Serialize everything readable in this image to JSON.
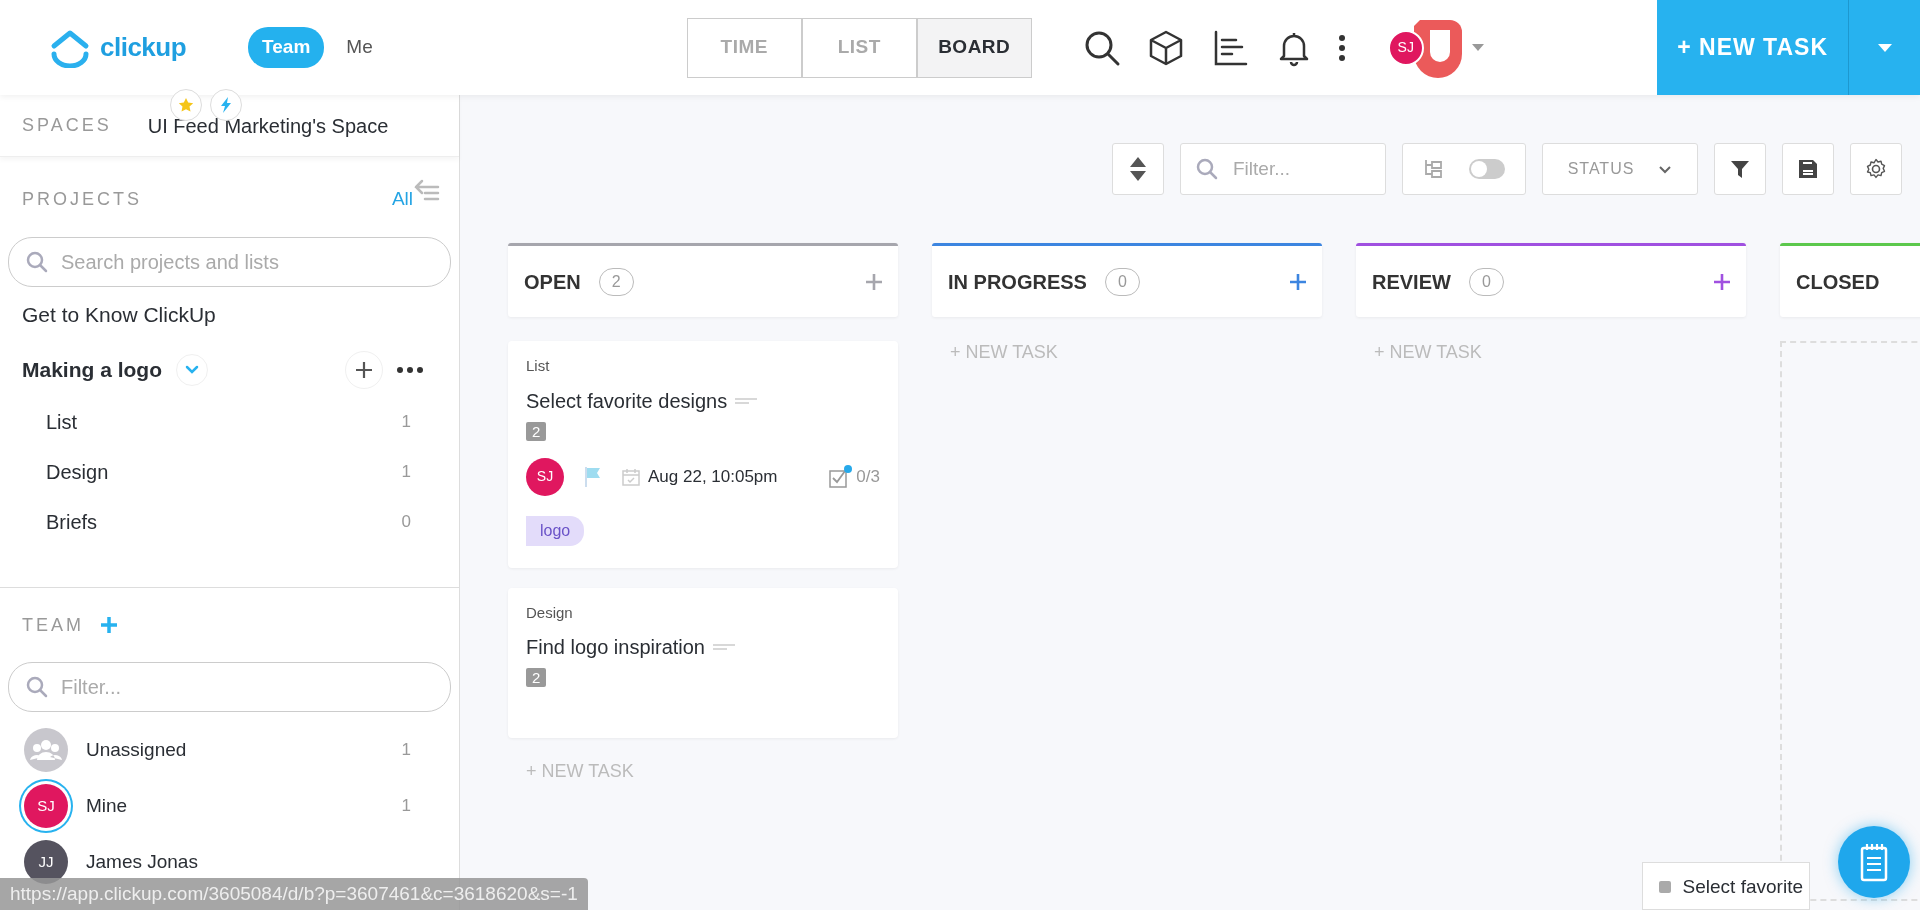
{
  "header": {
    "logo": "clickup",
    "scopes": [
      {
        "label": "Team",
        "selected": true
      },
      {
        "label": "Me",
        "selected": false
      }
    ],
    "views": [
      {
        "label": "TIME",
        "selected": false
      },
      {
        "label": "LIST",
        "selected": false
      },
      {
        "label": "BOARD",
        "selected": true
      }
    ],
    "avatar": "SJ",
    "new_task": "+ NEW TASK"
  },
  "sidebar": {
    "spaces_label": "SPACES",
    "space_name": "UI Feed Marketing's Space",
    "projects_label": "PROJECTS",
    "all_link": "All",
    "search": {
      "placeholder": "Search projects and lists"
    },
    "projects": [
      {
        "name": "Get to Know ClickUp",
        "expanded": false
      },
      {
        "name": "Making a logo",
        "expanded": true,
        "lists": [
          {
            "name": "List",
            "count": "1"
          },
          {
            "name": "Design",
            "count": "1"
          },
          {
            "name": "Briefs",
            "count": "0"
          }
        ]
      }
    ],
    "team_label": "TEAM",
    "filter": {
      "placeholder": "Filter..."
    },
    "members": [
      {
        "kind": "group",
        "name": "Unassigned",
        "count": "1",
        "selected": false
      },
      {
        "kind": "user",
        "initials": "SJ",
        "name": "Mine",
        "count": "1",
        "selected": true,
        "color": "#e0175f"
      },
      {
        "kind": "user",
        "initials": "JJ",
        "name": "James Jonas",
        "selected": false,
        "color": "#55535f"
      }
    ]
  },
  "toolbar": {
    "filter": {
      "placeholder": "Filter..."
    },
    "subtasks_on": false,
    "status": "STATUS"
  },
  "columns": [
    {
      "name": "OPEN",
      "count": "2",
      "color": "#a6a6ad",
      "new_task": "+ NEW TASK",
      "tasks": [
        {
          "list": "List",
          "title": "Select favorite designs",
          "subtasks": "2",
          "assignee": "SJ",
          "due": "Aug 22, 10:05pm",
          "checklist": "0/3",
          "tags": [
            "logo"
          ]
        },
        {
          "list": "Design",
          "title": "Find logo inspiration",
          "subtasks": "2"
        }
      ]
    },
    {
      "name": "IN PROGRESS",
      "count": "0",
      "color": "#3c85e0",
      "new_task": "+ NEW TASK"
    },
    {
      "name": "REVIEW",
      "count": "0",
      "color": "#a050e0",
      "new_task": "+ NEW TASK"
    },
    {
      "name": "CLOSED",
      "color": "#5cc84c"
    }
  ],
  "drag_preview": "Select favorite",
  "status_url": "https://app.clickup.com/3605084/d/b?p=3607461&c=3618620&s=-1"
}
